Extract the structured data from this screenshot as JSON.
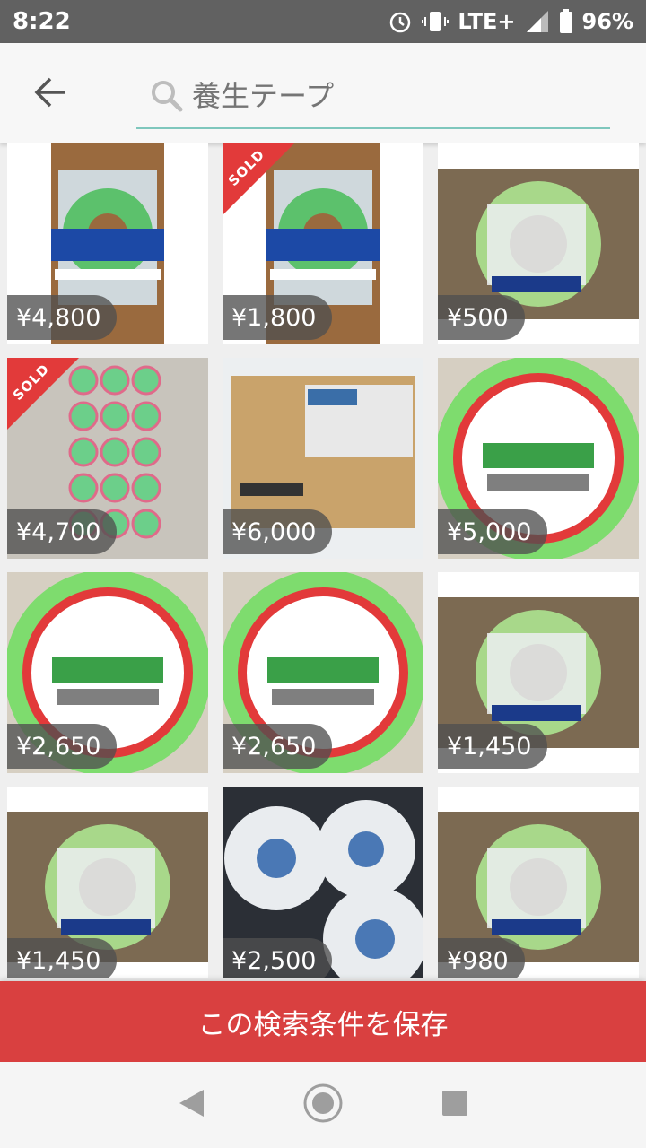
{
  "status": {
    "time": "8:22",
    "network": "LTE+",
    "battery": "96%"
  },
  "header": {
    "back_icon": "arrow-left-icon",
    "search_icon": "search-icon",
    "search_placeholder": "養生テープ"
  },
  "listings": [
    {
      "price": "¥4,800",
      "sold": false,
      "photo": "cut-tape",
      "sold_label": ""
    },
    {
      "price": "¥1,800",
      "sold": true,
      "photo": "cut-tape",
      "sold_label": "SOLD"
    },
    {
      "price": "¥500",
      "sold": false,
      "photo": "carpet-tape",
      "sold_label": ""
    },
    {
      "price": "¥4,700",
      "sold": true,
      "photo": "many-rolls",
      "sold_label": "SOLD"
    },
    {
      "price": "¥6,000",
      "sold": false,
      "photo": "box",
      "sold_label": ""
    },
    {
      "price": "¥5,000",
      "sold": false,
      "photo": "green-tape",
      "sold_label": ""
    },
    {
      "price": "¥2,650",
      "sold": false,
      "photo": "green-tape",
      "sold_label": ""
    },
    {
      "price": "¥2,650",
      "sold": false,
      "photo": "green-tape",
      "sold_label": ""
    },
    {
      "price": "¥1,450",
      "sold": false,
      "photo": "carpet-tape",
      "sold_label": ""
    },
    {
      "price": "¥1,450",
      "sold": false,
      "photo": "carpet-tape",
      "sold_label": ""
    },
    {
      "price": "¥2,500",
      "sold": false,
      "photo": "white-rolls",
      "sold_label": ""
    },
    {
      "price": "¥980",
      "sold": false,
      "photo": "carpet-tape",
      "sold_label": ""
    }
  ],
  "save_search_label": "この検索条件を保存",
  "colors": {
    "accent": "#d94040",
    "search_underline": "#7fc7bd",
    "sold_ribbon": "#e23a3a"
  }
}
